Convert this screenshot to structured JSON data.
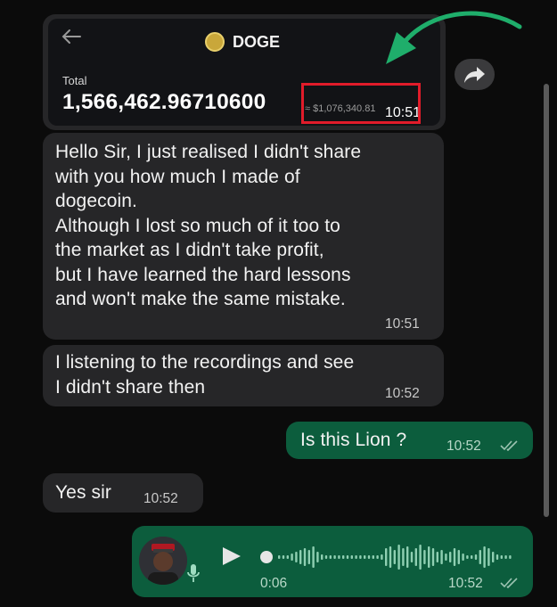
{
  "card": {
    "coin_name": "DOGE",
    "total_label": "Total",
    "balance": "1,566,462.96710600",
    "usd_value": "≈ $1,076,340.81",
    "time": "10:51"
  },
  "messages": [
    {
      "direction": "in",
      "text": "Hello Sir, I just realised I didn't share\nwith you how much I made of\ndogecoin.\nAlthough I lost so much of it too to\nthe market as I didn't take profit,\nbut I have learned the hard lessons\nand won't make the same mistake.",
      "time": "10:51"
    },
    {
      "direction": "in",
      "text": "I listening to the recordings and see\nI didn't share then",
      "time": "10:52"
    },
    {
      "direction": "out",
      "text": "Is this Lion ?",
      "time": "10:52",
      "status": "read"
    },
    {
      "direction": "in",
      "text": "Yes sir",
      "time": "10:52"
    }
  ],
  "voice_note": {
    "duration": "0:06",
    "time": "10:52",
    "status": "read"
  },
  "icons": {
    "back": "back-arrow-icon",
    "share": "forward-share-icon",
    "play": "play-icon",
    "mic": "microphone-icon",
    "ticks": "double-check-icon"
  },
  "colors": {
    "incoming_bubble": "#262628",
    "outgoing_bubble": "#0c5d3d",
    "highlight_box": "#e11c2a",
    "annotation_arrow": "#1fae6b"
  }
}
